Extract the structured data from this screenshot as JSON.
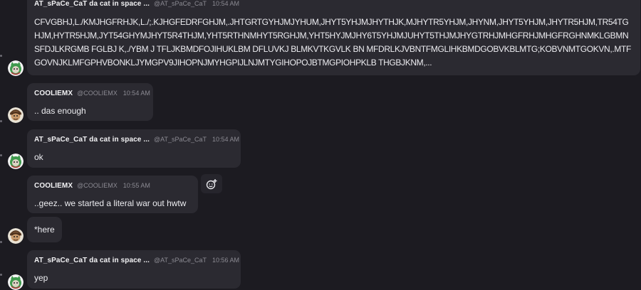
{
  "messages": [
    {
      "author": "AT_sPaCe_CaT da cat in space ...",
      "handle": "@AT_sPaCe_CaT",
      "time": "10:54 AM",
      "text": "CFVGBHJ,L./KMJHGFRHJK,L./;.KJHGFEDRFGHJM,.JHTGRTGYHJMJYHUM,JHYT5YHJMJHYTHJK,MJHYTR5YHJM,JHYNM,JHYT5YHJM,JHYTR5HJM,TR54TGHJM,HYTR5HJM,JYT54GHYMJHYT5R4THJM,YHT5RTHNMHYT5RGHJM,YHT5HYJMJHY6T5YHJMJUHYT5THJMJHYGTRHJMHGFRHJMHGFRGHNMKLGBMNSFDJLKRGMB FGLBJ K,./YBM J TFLJKBMDFOJIHUKLBM DFLUVKJ BLMKVTKGVLK BN MFDRLKJVBNTFMGLIHKBMDGOBVKBLMTG;KOBVNMTGOKVN,.MTFGOVNJKLMFGPHVBONKLJYMGPV9JIHOPNJMYHGPIJLNJMTYGIHOPOJBTMGPIOHPKLB THGBJKNM,..."
    },
    {
      "author": "COOLIEMX",
      "handle": "@COOLIEMX",
      "time": "10:54 AM",
      "text": ".. das enough"
    },
    {
      "author": "AT_sPaCe_CaT da cat in space ...",
      "handle": "@AT_sPaCe_CaT",
      "time": "10:54 AM",
      "text": "ok"
    },
    {
      "author": "COOLIEMX",
      "handle": "@COOLIEMX",
      "time": "10:55 AM",
      "text": "..geez.. we started a literal war out hwtw"
    },
    {
      "text": "*here"
    },
    {
      "author": "AT_sPaCe_CaT da cat in space ...",
      "handle": "@AT_sPaCe_CaT",
      "time": "10:56 AM",
      "text": "yep"
    }
  ],
  "icons": {
    "react": "add-reaction-icon",
    "avatar_cat": "green-cat-avatar",
    "avatar_coolie": "brown-character-avatar"
  },
  "colors": {
    "background": "#1c1b21",
    "bubble": "#2b2a31",
    "muted_text": "#8b8a92",
    "body_text": "#ececf0"
  }
}
